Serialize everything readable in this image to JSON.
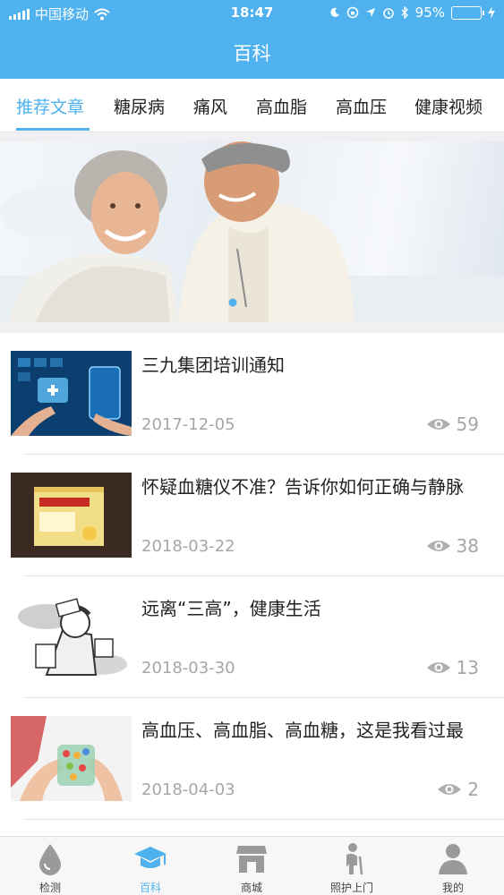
{
  "status_bar": {
    "carrier": "中国移动",
    "time": "18:47",
    "battery": "95%",
    "battery_level": 0.95
  },
  "header": {
    "title": "百科"
  },
  "tabs": [
    {
      "label": "推荐文章",
      "active": true
    },
    {
      "label": "糖尿病",
      "active": false
    },
    {
      "label": "痛风",
      "active": false
    },
    {
      "label": "高血脂",
      "active": false
    },
    {
      "label": "高血压",
      "active": false
    },
    {
      "label": "健康视频",
      "active": false
    }
  ],
  "banner": {
    "image": "elderly-couple-photo",
    "page_count": 1,
    "current_page": 1
  },
  "articles": [
    {
      "title": "三九集团培训通知",
      "date": "2017-12-05",
      "views": "59",
      "thumb": "medical-tech-hands"
    },
    {
      "title": "怀疑血糖仪不准？告诉你如何正确与静脉",
      "date": "2018-03-22",
      "views": "38",
      "thumb": "medicine-box"
    },
    {
      "title": "远离“三高”，健康生活",
      "date": "2018-03-30",
      "views": "13",
      "thumb": "cartoon-illustration"
    },
    {
      "title": "高血压、高血脂、高血糖，这是我看过最",
      "date": "2018-04-03",
      "views": "2",
      "thumb": "hands-holding-pills"
    }
  ],
  "bottom_nav": [
    {
      "label": "检测",
      "icon": "drop-icon",
      "active": false
    },
    {
      "label": "百科",
      "icon": "graduation-cap-icon",
      "active": true
    },
    {
      "label": "商城",
      "icon": "store-icon",
      "active": false
    },
    {
      "label": "照护上门",
      "icon": "elder-care-icon",
      "active": false
    },
    {
      "label": "我的",
      "icon": "user-icon",
      "active": false
    }
  ],
  "colors": {
    "primary": "#4fb2ee",
    "muted": "#a6a6a6",
    "battery": "#8ee06b"
  }
}
